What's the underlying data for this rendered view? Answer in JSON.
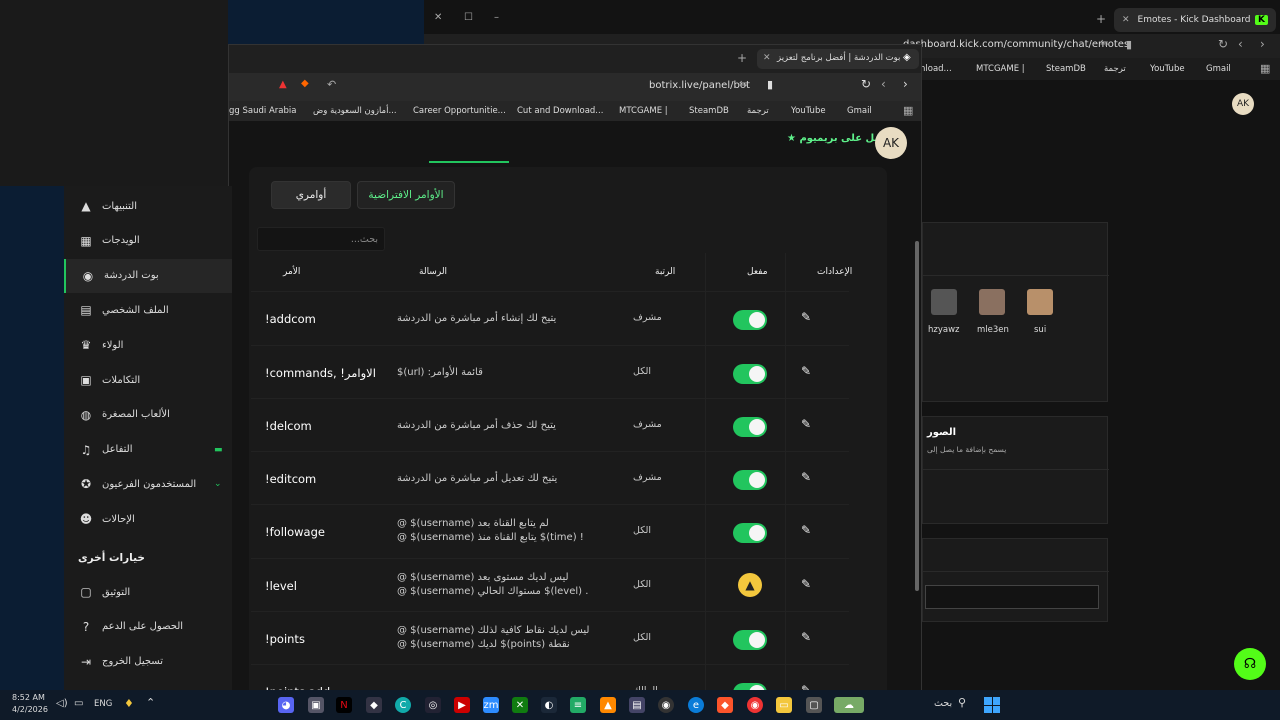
{
  "bg_window": {
    "tab_title": "Emotes - Kick Dashboard",
    "kick_logo": "K",
    "address": "dashboard.kick.com/community/chat/emotes",
    "bookmarks": [
      "nload...",
      "MTCGAME |",
      "SteamDB",
      "ترجمة",
      "YouTube",
      "Gmail"
    ],
    "avatar": "AK",
    "emotes": [
      "hzyawz",
      "mle3en",
      "sui"
    ],
    "section_title": "الصور",
    "section_desc": "يسمح بإضافة ما يصل إلى"
  },
  "fg_window": {
    "tab_title": "بوت الدردشة | أفضل برنامج لتعزيز",
    "address": "botrix.live/panel/bot",
    "bookmarks": [
      "gg Saudi Arabia",
      "أمازون السعودية وض...",
      "Career Opportunitie...",
      "Cut and Download...",
      "MTCGAME |",
      "SteamDB",
      "ترجمة",
      "YouTube",
      "Gmail"
    ],
    "premium": "احصل على بريميوم",
    "avatar": "AK",
    "tabs": {
      "default_commands": "الأوامر الافتراضية",
      "my_commands": "أوامري"
    },
    "search_placeholder": "بحث...",
    "headers": {
      "command": "الأمر",
      "message": "الرسالة",
      "role": "الرتبة",
      "enabled": "مفعل",
      "settings": "الإعدادات"
    },
    "rows": [
      {
        "command": "!addcom",
        "message1": "يتيح لك إنشاء أمر مباشرة من الدردشة",
        "message2": "",
        "role": "مشرف",
        "status": "on"
      },
      {
        "command": "!commands, !الاوامر",
        "message1": "$(url) :قائمة الأوامر",
        "message2": "",
        "role": "الكل",
        "status": "on"
      },
      {
        "command": "!delcom",
        "message1": "يتيح لك حذف أمر مباشرة من الدردشة",
        "message2": "",
        "role": "مشرف",
        "status": "on"
      },
      {
        "command": "!editcom",
        "message1": "يتيح لك تعديل أمر مباشرة من الدردشة",
        "message2": "",
        "role": "مشرف",
        "status": "on"
      },
      {
        "command": "!followage",
        "message1": "@ $(username) لم يتابع القناة بعد",
        "message2": "@ $(username) يتابع القناة منذ $(time) !",
        "role": "الكل",
        "status": "on"
      },
      {
        "command": "!level",
        "message1": "@ $(username) ليس لديك مستوى بعد",
        "message2": "@ $(username) مستواك الحالي $(level) .",
        "role": "الكل",
        "status": "warn"
      },
      {
        "command": "!points",
        "message1": "@ $(username) ليس لديك نقاط كافية لذلك",
        "message2": "@ $(username) لديك $(points) نقطة",
        "role": "الكل",
        "status": "on"
      },
      {
        "command": "!points add",
        "message1": "",
        "message2": "",
        "role": "المالك",
        "status": "on"
      }
    ]
  },
  "sidebar": {
    "items": [
      {
        "label": "التنبيهات",
        "icon": "▲"
      },
      {
        "label": "الويدجات",
        "icon": "▦"
      },
      {
        "label": "بوت الدردشة",
        "icon": "◉"
      },
      {
        "label": "الملف الشخصي",
        "icon": "▤"
      },
      {
        "label": "الولاء",
        "icon": "♛"
      },
      {
        "label": "التكاملات",
        "icon": "▣"
      },
      {
        "label": "الألعاب المصغرة",
        "icon": "◍"
      },
      {
        "label": "التفاعل",
        "icon": "♫"
      },
      {
        "label": "المستخدمون الفرعيون",
        "icon": "✪"
      },
      {
        "label": "الإحالات",
        "icon": "☻"
      }
    ],
    "other_title": "خيارات أخرى",
    "other_items": [
      {
        "label": "التوثيق",
        "icon": "▢"
      },
      {
        "label": "الحصول على الدعم",
        "icon": "?"
      },
      {
        "label": "تسجيل الخروج",
        "icon": "⇥"
      }
    ]
  },
  "taskbar": {
    "time": "8:52 AM",
    "date": "4/2/2026",
    "lang": "ENG",
    "search": "بحث"
  },
  "colors": {
    "accent": "#22c55e",
    "warn": "#f3c73d",
    "kick": "#53fc18"
  }
}
